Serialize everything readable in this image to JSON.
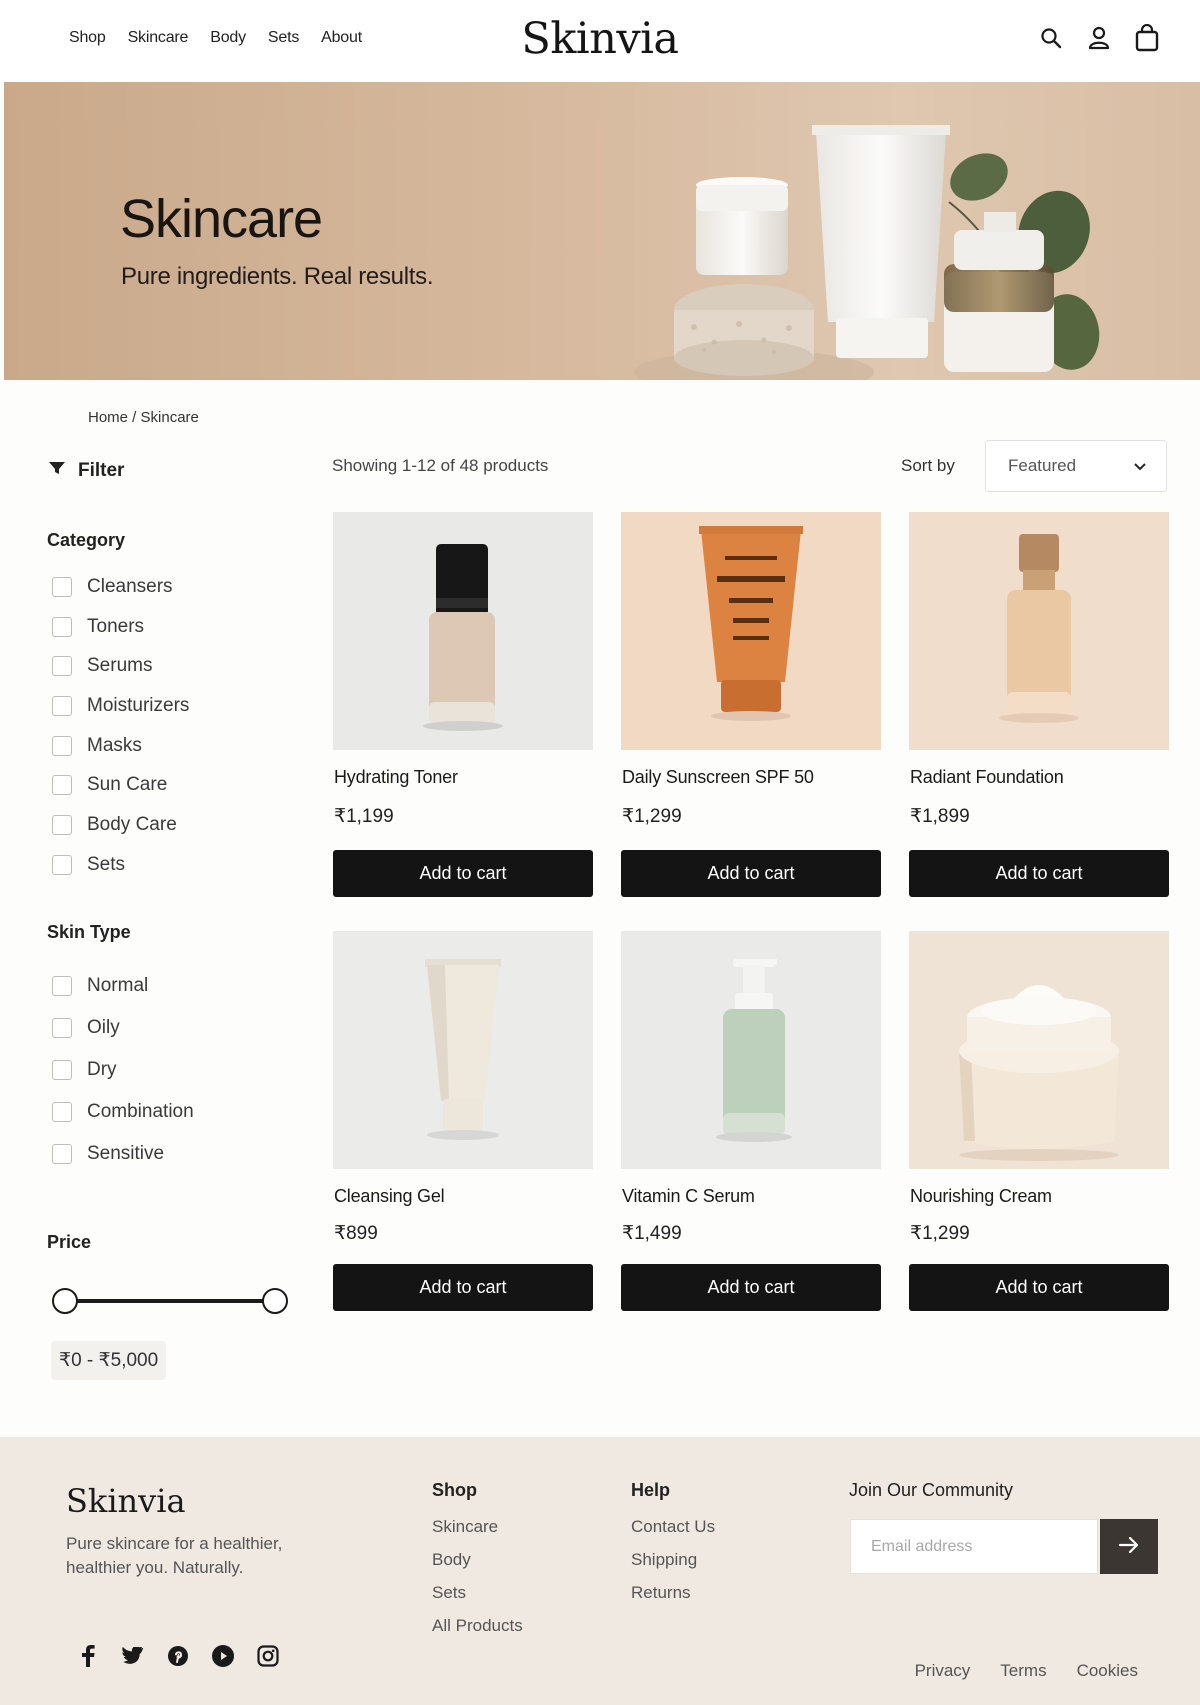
{
  "header": {
    "nav": [
      "Shop",
      "Skincare",
      "Body",
      "Sets",
      "About"
    ],
    "logo": "Skinvia",
    "icons": [
      "search-icon",
      "user-icon",
      "bag-icon"
    ]
  },
  "hero": {
    "title": "Skincare",
    "subtitle": "Pure ingredients. Real results."
  },
  "breadcrumb": "Home / Skincare",
  "sidebar": {
    "filter_label": "Filter",
    "category_title": "Category",
    "categories": [
      "Cleansers",
      "Toners",
      "Serums",
      "Moisturizers",
      "Masks",
      "Sun Care",
      "Body Care",
      "Sets"
    ],
    "skin_type_title": "Skin Type",
    "skin_types": [
      "Normal",
      "Oily",
      "Dry",
      "Combination",
      "Sensitive"
    ],
    "price_title": "Price",
    "price_range": "₹0 - ₹5,000",
    "price_min_fraction": 0,
    "price_max_fraction": 1
  },
  "toolbar": {
    "showing": "Showing 1-12 of 48 products",
    "sort_label": "Sort by",
    "sort_value": "Featured"
  },
  "products": [
    {
      "name": "Hydrating Toner",
      "price": "₹1,199",
      "button": "Add to cart"
    },
    {
      "name": "Daily Sunscreen SPF 50",
      "price": "₹1,299",
      "button": "Add to cart"
    },
    {
      "name": "Radiant Foundation",
      "price": "₹1,899",
      "button": "Add to cart"
    },
    {
      "name": "Cleansing Gel",
      "price": "₹899",
      "button": "Add to cart"
    },
    {
      "name": "Vitamin C Serum",
      "price": "₹1,499",
      "button": "Add to cart"
    },
    {
      "name": "Nourishing Cream",
      "price": "₹1,299",
      "button": "Add to cart"
    }
  ],
  "footer": {
    "logo": "Skinvia",
    "tagline": "Pure skincare for a healthier, healthier you. Naturally.",
    "shop_title": "Shop",
    "shop_links": [
      "Skincare",
      "Body",
      "Sets",
      "All Products"
    ],
    "help_title": "Help",
    "help_links": [
      "Contact Us",
      "Shipping",
      "Returns"
    ],
    "join_title": "Join Our Community",
    "email_placeholder": "Email address",
    "social": [
      "facebook-icon",
      "twitter-icon",
      "pinterest-icon",
      "youtube-icon",
      "instagram-icon"
    ],
    "legal": [
      "Privacy",
      "Terms",
      "Cookies"
    ]
  },
  "colors": {
    "button": "#141414",
    "hero_bg": "#d6b99e",
    "footer_bg": "#efe9e1",
    "submit_bg": "#3b3631"
  }
}
